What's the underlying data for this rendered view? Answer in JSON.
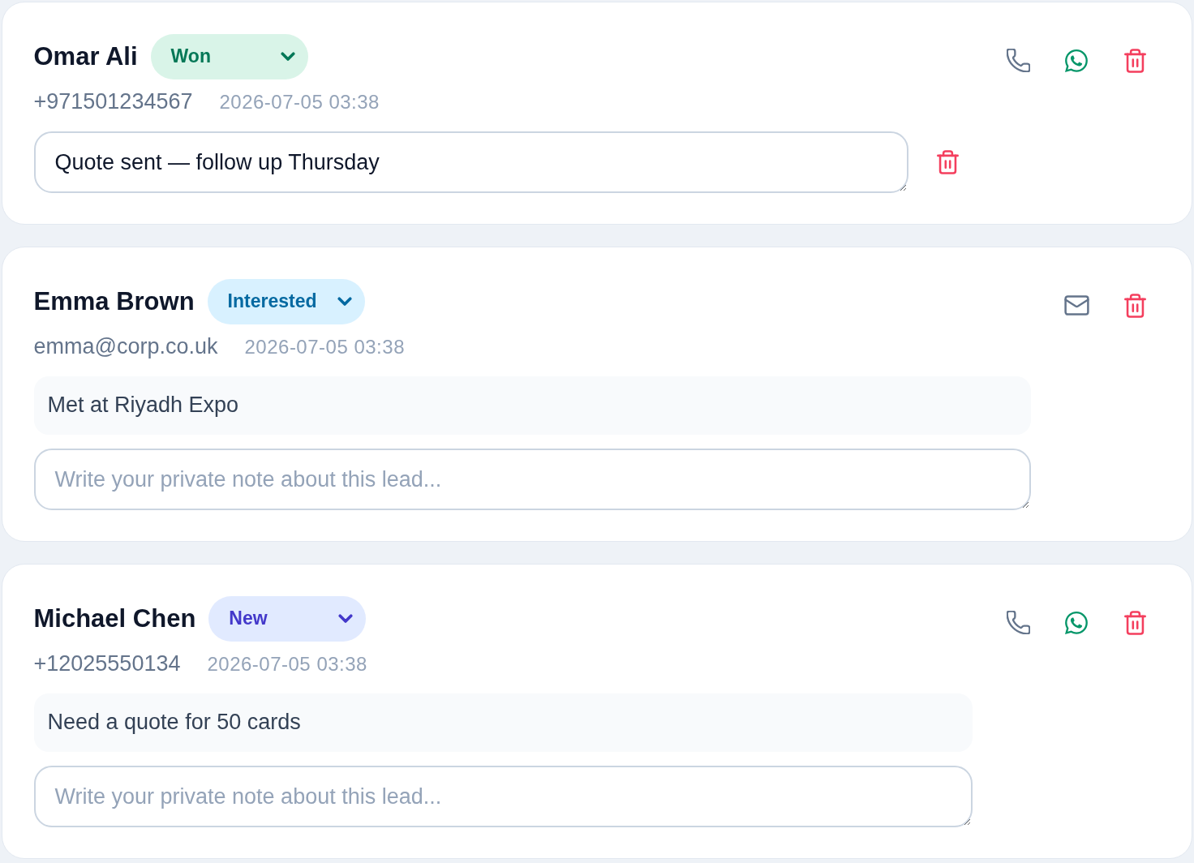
{
  "leads": [
    {
      "name": "Omar Ali",
      "status": {
        "label": "Won",
        "color": "#047857"
      },
      "contact": {
        "kind": "phone",
        "value": "+971501234567"
      },
      "timestamp": "2026-07-05 03:38",
      "note": {
        "value": "Quote sent — follow up Thursday"
      }
    },
    {
      "name": "Emma Brown",
      "status": {
        "label": "Interested",
        "color": "#0369a1"
      },
      "contact": {
        "kind": "email",
        "value": "emma@corp.co.uk"
      },
      "timestamp": "2026-07-05 03:38",
      "message": "Met at Riyadh Expo",
      "note": {
        "placeholder": "Write your private note about this lead..."
      }
    },
    {
      "name": "Michael Chen",
      "status": {
        "label": "New",
        "color": "#4338ca"
      },
      "contact": {
        "kind": "phone",
        "value": "+12025550134"
      },
      "timestamp": "2026-07-05 03:38",
      "message": "Need a quote for 50 cards",
      "note": {
        "placeholder": "Write your private note about this lead..."
      }
    }
  ]
}
